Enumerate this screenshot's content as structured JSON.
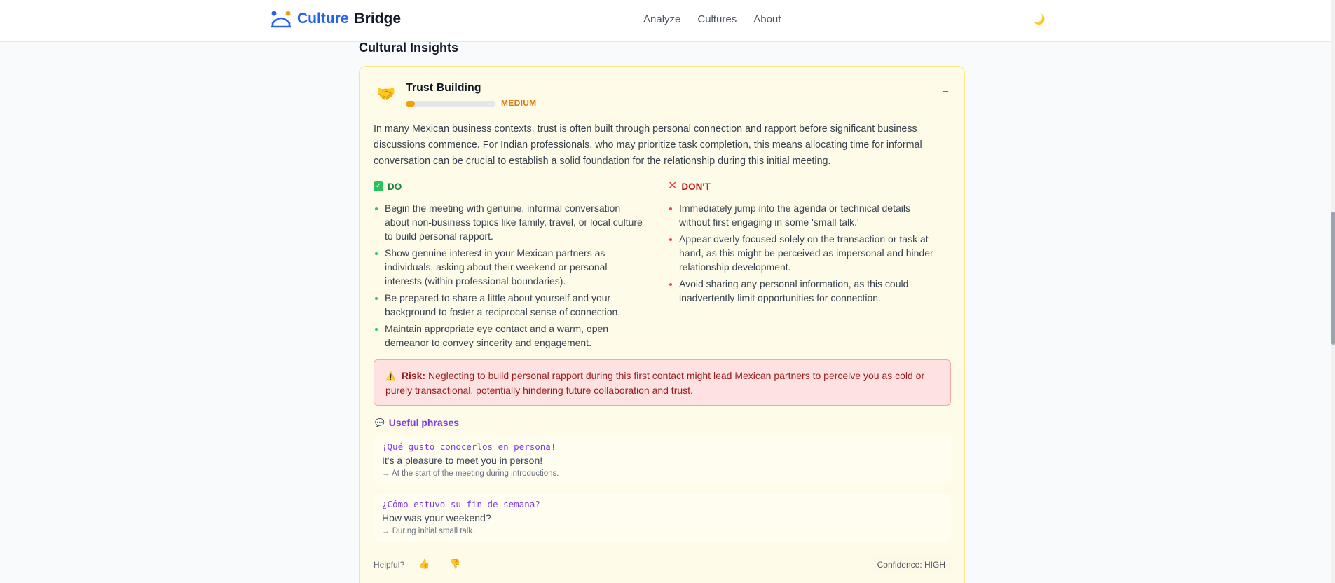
{
  "header": {
    "logo_word1": "Culture",
    "logo_word2": "Bridge",
    "nav": [
      "Analyze",
      "Cultures",
      "About"
    ],
    "theme_icon": "🌙"
  },
  "section_title": "Cultural Insights",
  "card": {
    "icon": "🤝",
    "title": "Trust Building",
    "level_label": "MEDIUM",
    "level_fraction": 0.1,
    "collapse_symbol": "−",
    "description": "In many Mexican business contexts, trust is often built through personal connection and rapport before significant business discussions commence. For Indian professionals, who may prioritize task completion, this means allocating time for informal conversation can be crucial to establish a solid foundation for the relationship during this initial meeting.",
    "do_title": "DO",
    "do_icon": "✓",
    "do_items": [
      "Begin the meeting with genuine, informal conversation about non-business topics like family, travel, or local culture to build personal rapport.",
      "Show genuine interest in your Mexican partners as individuals, asking about their weekend or personal interests (within professional boundaries).",
      "Be prepared to share a little about yourself and your background to foster a reciprocal sense of connection.",
      "Maintain appropriate eye contact and a warm, open demeanor to convey sincerity and engagement."
    ],
    "dont_title": "DON'T",
    "dont_icon": "✕",
    "dont_items": [
      "Immediately jump into the agenda or technical details without first engaging in some 'small talk.'",
      "Appear overly focused solely on the transaction or task at hand, as this might be perceived as impersonal and hinder relationship development.",
      "Avoid sharing any personal information, as this could inadvertently limit opportunities for connection."
    ],
    "risk_icon": "⚠️",
    "risk_label": "Risk:",
    "risk_text": "Neglecting to build personal rapport during this first contact might lead Mexican partners to perceive you as cold or purely transactional, potentially hindering future collaboration and trust.",
    "phrases_icon": "💬",
    "phrases_title": "Useful phrases",
    "phrases": [
      {
        "original": "¡Qué gusto conocerlos en persona!",
        "translation": "It's a pleasure to meet you in person!",
        "context": "→ At the start of the meeting during introductions."
      },
      {
        "original": "¿Cómo estuvo su fin de semana?",
        "translation": "How was your weekend?",
        "context": "→ During initial small talk."
      }
    ],
    "helpful_label": "Helpful?",
    "thumb_up": "👍",
    "thumb_down": "👎",
    "confidence": "Confidence: HIGH"
  },
  "colors": {
    "brand": "#2563eb",
    "card_bg": "#fefce8",
    "level": "#f59e0b",
    "do": "#15803d",
    "dont": "#b91c1c",
    "phrase": "#7c3aed"
  }
}
